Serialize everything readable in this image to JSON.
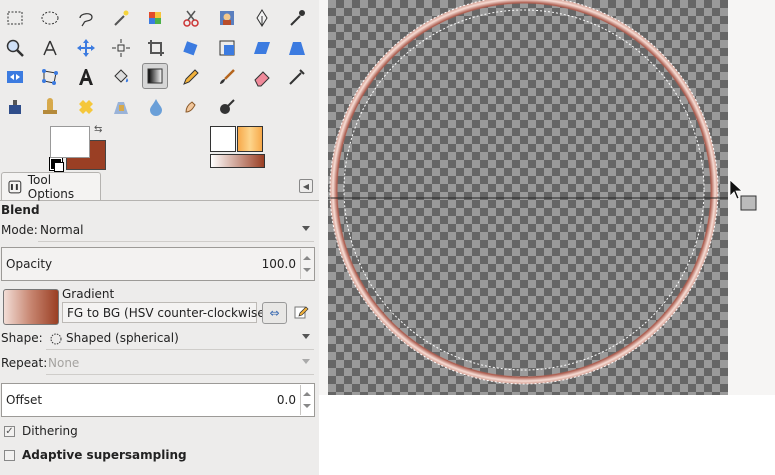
{
  "toolbox": {
    "tools": [
      {
        "name": "rect-select-icon"
      },
      {
        "name": "ellipse-select-icon"
      },
      {
        "name": "free-select-icon"
      },
      {
        "name": "fuzzy-select-icon"
      },
      {
        "name": "color-select-icon"
      },
      {
        "name": "scissors-select-icon"
      },
      {
        "name": "foreground-select-icon"
      },
      {
        "name": "paths-icon"
      },
      {
        "name": "color-picker-icon"
      },
      {
        "name": "zoom-icon"
      },
      {
        "name": "measure-icon"
      },
      {
        "name": "move-icon"
      },
      {
        "name": "align-icon"
      },
      {
        "name": "crop-icon"
      },
      {
        "name": "rotate-icon"
      },
      {
        "name": "scale-icon"
      },
      {
        "name": "shear-icon"
      },
      {
        "name": "perspective-icon"
      },
      {
        "name": "flip-icon"
      },
      {
        "name": "cage-transform-icon"
      },
      {
        "name": "text-icon"
      },
      {
        "name": "bucket-fill-icon"
      },
      {
        "name": "blend-icon"
      },
      {
        "name": "pencil-icon"
      },
      {
        "name": "paintbrush-icon"
      },
      {
        "name": "eraser-icon"
      },
      {
        "name": "airbrush-icon"
      },
      {
        "name": "ink-icon"
      },
      {
        "name": "clone-icon"
      },
      {
        "name": "heal-icon"
      },
      {
        "name": "perspective-clone-icon"
      },
      {
        "name": "blur-icon"
      },
      {
        "name": "smudge-icon"
      },
      {
        "name": "dodge-burn-icon"
      }
    ]
  },
  "colors": {
    "foreground": "#ffffff",
    "background": "#9a3f24"
  },
  "tab": {
    "label": "Tool Options"
  },
  "options": {
    "title": "Blend",
    "mode_label": "Mode:",
    "mode_value": "Normal",
    "opacity_label": "Opacity",
    "opacity_value": "100.0",
    "gradient_label": "Gradient",
    "gradient_value": "FG to BG (HSV counter-clockwise)",
    "shape_label": "Shape:",
    "shape_value": "Shaped (spherical)",
    "repeat_label": "Repeat:",
    "repeat_value": "None",
    "offset_label": "Offset",
    "offset_value": "0.0",
    "dithering_label": "Dithering",
    "dithering_checked": true,
    "adaptive_label": "Adaptive supersampling",
    "adaptive_checked": false
  },
  "canvas": {
    "ring_color": "#d8968a"
  }
}
